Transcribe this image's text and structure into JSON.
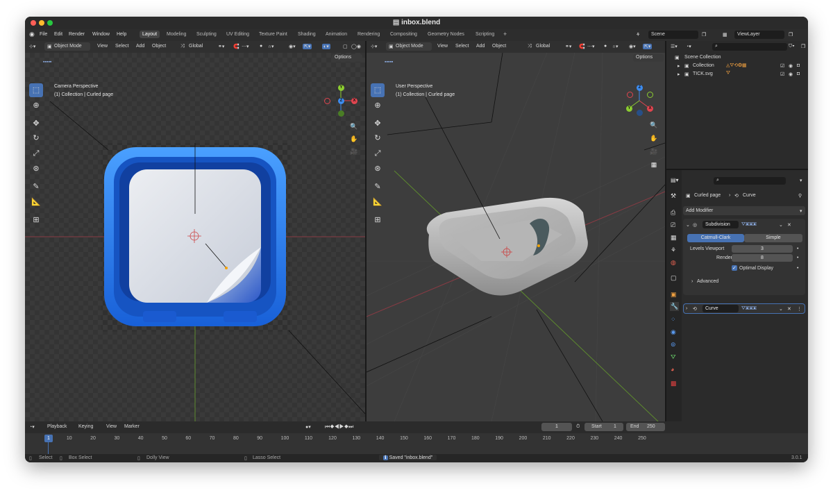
{
  "window": {
    "title": "inbox.blend"
  },
  "menu": [
    "File",
    "Edit",
    "Render",
    "Window",
    "Help"
  ],
  "workspaces": [
    "Layout",
    "Modeling",
    "Sculpting",
    "UV Editing",
    "Texture Paint",
    "Shading",
    "Animation",
    "Rendering",
    "Compositing",
    "Geometry Nodes",
    "Scripting"
  ],
  "workspace_add": "+",
  "scene": {
    "name": "Scene",
    "view_layer": "ViewLayer"
  },
  "viewport_header": {
    "mode": "Object Mode",
    "view": "View",
    "select": "Select",
    "add": "Add",
    "object": "Object",
    "transform": "Global",
    "options": "Options"
  },
  "left_viewport": {
    "title": "Camera Perspective",
    "subtitle": "(1) Collection | Curled page"
  },
  "right_viewport": {
    "title": "User Perspective",
    "subtitle": "(1) Collection | Curled page"
  },
  "gizmo": {
    "x": "X",
    "y": "Y",
    "z": "Z"
  },
  "outliner": {
    "root": "Scene Collection",
    "items": [
      {
        "name": "Collection"
      },
      {
        "name": "TICK.svg"
      }
    ]
  },
  "properties": {
    "object": "Curled page",
    "data": "Curve",
    "add_modifier": "Add Modifier",
    "modifiers": [
      {
        "name": "Subdivision",
        "mode_a": "Catmull-Clark",
        "mode_b": "Simple",
        "levels_label": "Levels Viewport",
        "levels": "3",
        "render_label": "Render",
        "render": "8",
        "optimal_label": "Optimal Display",
        "advanced": "Advanced"
      },
      {
        "name": "Curve"
      }
    ]
  },
  "timeline": {
    "menus": [
      "Playback",
      "Keying",
      "View",
      "Marker"
    ],
    "current": "1",
    "start_label": "Start",
    "start": "1",
    "end_label": "End",
    "end": "250",
    "ticks": [
      "1",
      "10",
      "20",
      "30",
      "40",
      "50",
      "60",
      "70",
      "80",
      "90",
      "100",
      "110",
      "120",
      "130",
      "140",
      "150",
      "160",
      "170",
      "180",
      "190",
      "200",
      "210",
      "220",
      "230",
      "240",
      "250"
    ]
  },
  "status": {
    "select": "Select",
    "box_select": "Box Select",
    "dolly": "Dolly View",
    "lasso": "Lasso Select",
    "message": "Saved \"inbox.blend\"",
    "version": "3.0.1"
  },
  "colors": {
    "accent": "#4772b3",
    "icon_blue": "#1f7ae8",
    "x_axis": "#e0454f",
    "y_axis": "#8ccc31",
    "z_axis": "#3d8cf0"
  }
}
